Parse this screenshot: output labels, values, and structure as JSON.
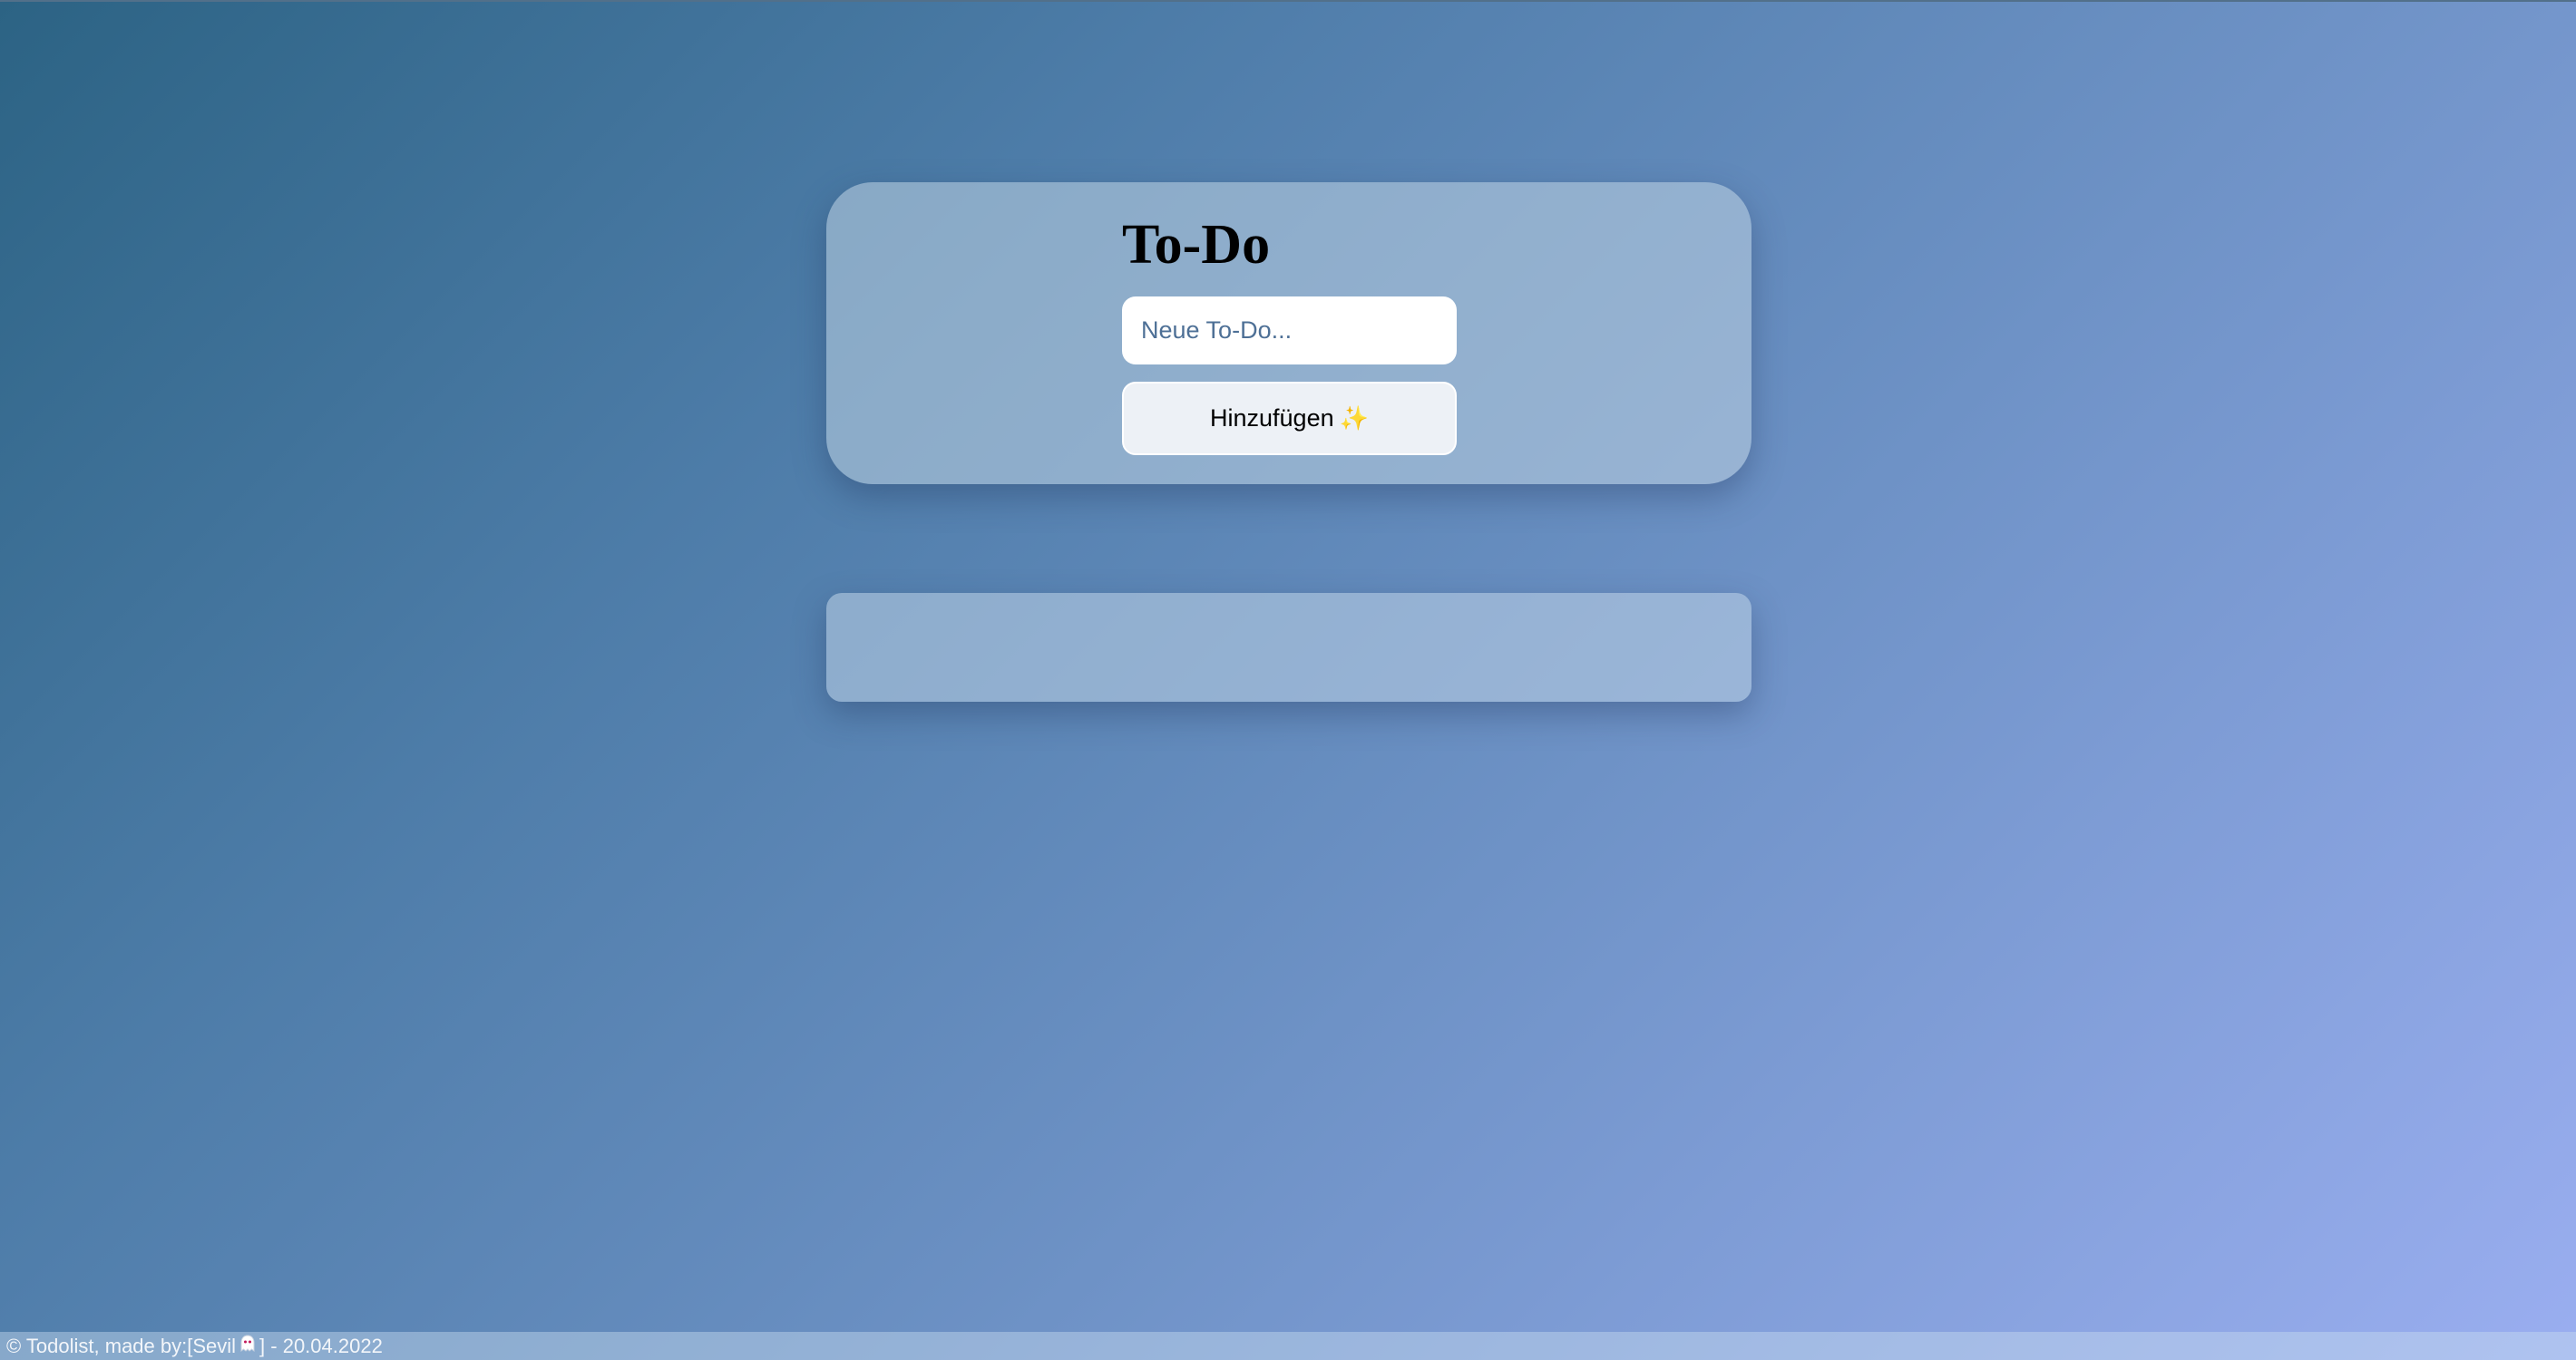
{
  "app": {
    "title": "To-Do"
  },
  "form": {
    "input_placeholder": "Neue To-Do...",
    "input_value": "",
    "add_label": "Hinzufügen",
    "add_icon": "sparkles-icon",
    "add_icon_glyph": "✨"
  },
  "list": {
    "items": []
  },
  "footer": {
    "prefix": "© Todolist, made by:[Sevil",
    "icon": "ghost-icon",
    "suffix": "] - 20.04.2022"
  },
  "colors": {
    "background_start": "#2c6384",
    "background_end": "#9aaef0",
    "card": "#a2b9d2",
    "button": "#edf1f6",
    "sparkle": "#f2c23a"
  }
}
